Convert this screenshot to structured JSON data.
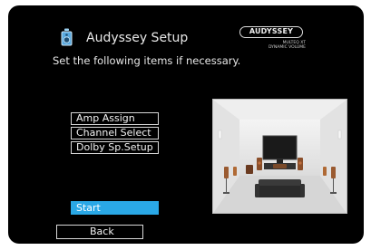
{
  "header": {
    "title": "Audyssey Setup",
    "subtitle": "Set the following items if necessary."
  },
  "logo": {
    "brand": "AUDYSSEY",
    "line1": "MULTEQ XT",
    "line2": "DYNAMIC VOLUME"
  },
  "menu": {
    "items": [
      {
        "label": "Amp Assign"
      },
      {
        "label": "Channel Select"
      },
      {
        "label": "Dolby Sp.Setup"
      }
    ],
    "start_label": "Start",
    "back_label": "Back"
  },
  "colors": {
    "background": "#000000",
    "highlight": "#2aa8e6",
    "text": "#e8e8e8"
  },
  "icons": {
    "title": "speaker-icon",
    "illustration": "room-speaker-layout"
  }
}
